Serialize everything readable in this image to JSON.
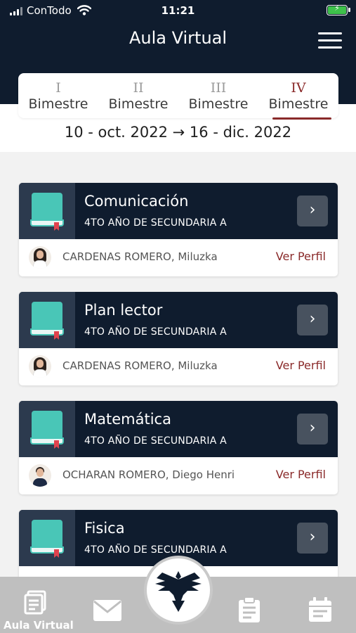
{
  "status_bar": {
    "carrier": "ConTodo",
    "time": "11:21"
  },
  "header": {
    "title": "Aula Virtual"
  },
  "bimestres": [
    {
      "roman": "I",
      "label": "Bimestre"
    },
    {
      "roman": "II",
      "label": "Bimestre"
    },
    {
      "roman": "III",
      "label": "Bimestre"
    },
    {
      "roman": "IV",
      "label": "Bimestre"
    }
  ],
  "active_bimestre": "IV",
  "date_range": "10 - oct. 2022 → 16 - dic. 2022",
  "courses": [
    {
      "name": "Comunicación",
      "grade": "4TO  AÑO DE SECUNDARIA A",
      "teacher": "CARDENAS ROMERO, Miluzka",
      "link": "Ver Perfil"
    },
    {
      "name": "Plan lector",
      "grade": "4TO  AÑO DE SECUNDARIA A",
      "teacher": "CARDENAS ROMERO, Miluzka",
      "link": "Ver Perfil"
    },
    {
      "name": "Matemática",
      "grade": "4TO  AÑO DE SECUNDARIA A",
      "teacher": "OCHARAN ROMERO, Diego Henri",
      "link": "Ver Perfil"
    },
    {
      "name": "Fisica",
      "grade": "4TO  AÑO DE SECUNDARIA A",
      "teacher": "",
      "link": ""
    }
  ],
  "bottom_nav": {
    "active_label": "Aula Virtual"
  },
  "colors": {
    "header_bg": "#0f1c2e",
    "accent": "#8a2a2a",
    "book": "#49c6b7",
    "nav_bg": "#bfbfbf"
  },
  "icons": [
    "signal-icon",
    "wifi-icon",
    "battery-icon",
    "menu-icon",
    "book-icon",
    "chevron-right-icon",
    "classroom-icon",
    "mail-icon",
    "eagle-logo-icon",
    "clipboard-icon",
    "calendar-icon"
  ]
}
